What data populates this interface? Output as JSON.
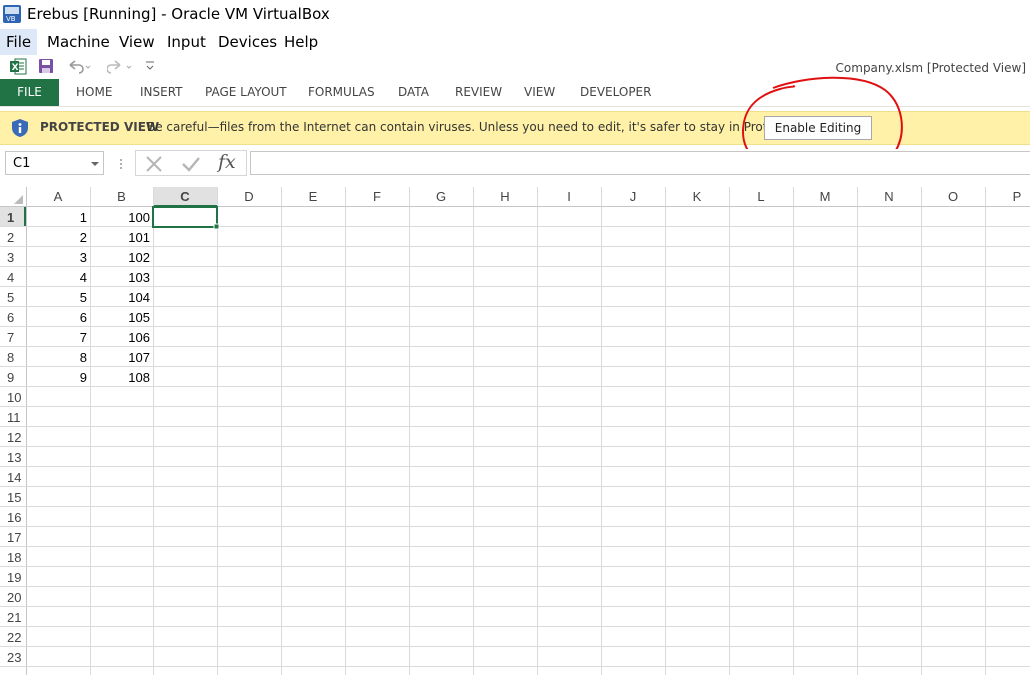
{
  "window": {
    "title": "Erebus [Running] - Oracle VM VirtualBox"
  },
  "menubar": {
    "items": [
      "File",
      "Machine",
      "View",
      "Input",
      "Devices",
      "Help"
    ],
    "active": "File"
  },
  "qat": {
    "icons": [
      "excel-logo-icon",
      "save-icon",
      "undo-icon",
      "redo-icon",
      "customize-qat-icon"
    ],
    "file_name": "Company.xlsm  [Protected View]"
  },
  "ribbon": {
    "tabs": [
      "FILE",
      "HOME",
      "INSERT",
      "PAGE LAYOUT",
      "FORMULAS",
      "DATA",
      "REVIEW",
      "VIEW",
      "DEVELOPER"
    ],
    "active_tab": "FILE",
    "accent_color": "#217346"
  },
  "protected_view": {
    "title": "PROTECTED VIEW",
    "message": "Be careful—files from the Internet can contain viruses. Unless you need to edit, it's safer to stay in Protected View.",
    "button": "Enable Editing",
    "annotation_color": "#e01010"
  },
  "formula_bar": {
    "name_box": "C1",
    "formula": ""
  },
  "sheet": {
    "columns": [
      "A",
      "B",
      "C",
      "D",
      "E",
      "F",
      "G",
      "H",
      "I",
      "J",
      "K",
      "L",
      "M",
      "N",
      "O",
      "P"
    ],
    "rows": [
      "1",
      "2",
      "3",
      "4",
      "5",
      "6",
      "7",
      "8",
      "9",
      "10",
      "11",
      "12",
      "13",
      "14",
      "15",
      "16",
      "17",
      "18",
      "19",
      "20",
      "21",
      "22",
      "23"
    ],
    "cells": {
      "A": [
        "1",
        "2",
        "3",
        "4",
        "5",
        "6",
        "7",
        "8",
        "9"
      ],
      "B": [
        "100",
        "101",
        "102",
        "103",
        "104",
        "105",
        "106",
        "107",
        "108"
      ]
    },
    "selected_cell": "C1",
    "selection_color": "#217346"
  }
}
